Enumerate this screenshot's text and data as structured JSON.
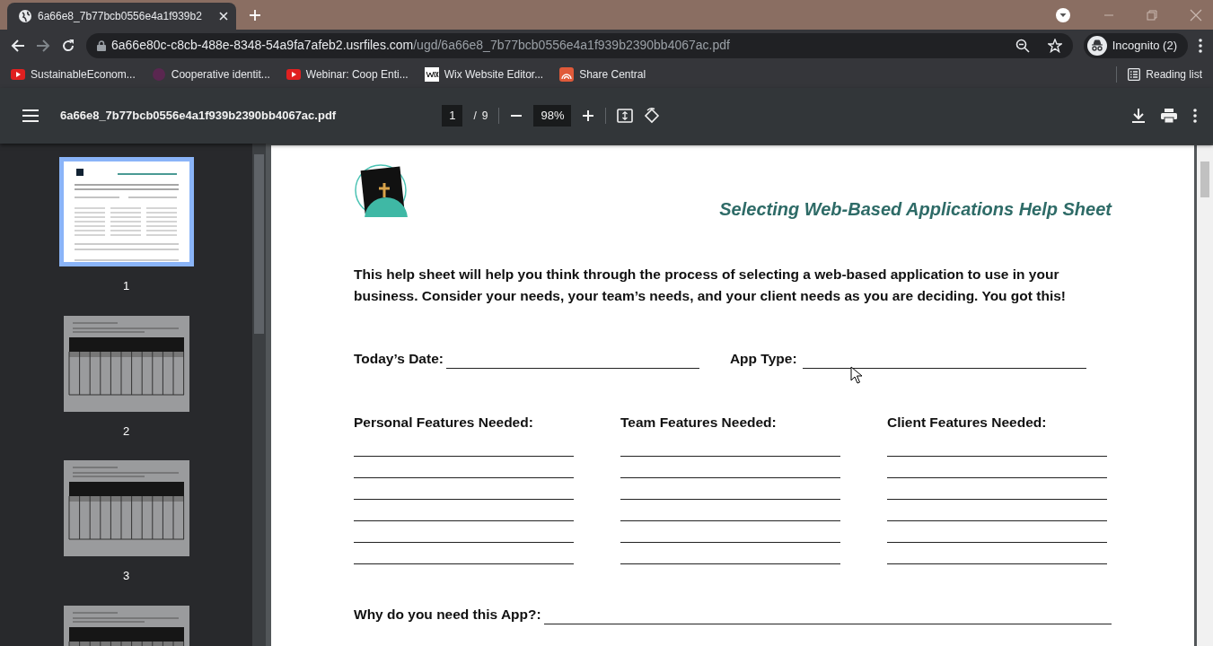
{
  "window": {
    "tab_title": "6a66e8_7b77bcb0556e4a1f939b2",
    "url_host": "6a66e80c-c8cb-488e-8348-54a9fa7afeb2.usrfiles.com",
    "url_path": "/ugd/6a66e8_7b77bcb0556e4a1f939b2390bb4067ac.pdf",
    "profile": "Incognito (2)",
    "bookmarks": [
      {
        "label": "SustainableEconom...",
        "kind": "video"
      },
      {
        "label": "Cooperative identit...",
        "kind": "site"
      },
      {
        "label": "Webinar: Coop Enti...",
        "kind": "video"
      },
      {
        "label": "Wix Website Editor...",
        "kind": "wix"
      },
      {
        "label": "Share Central",
        "kind": "share"
      }
    ],
    "reading_list": "Reading list"
  },
  "pdf_toolbar": {
    "filename": "6a66e8_7b77bcb0556e4a1f939b2390bb4067ac.pdf",
    "page": "1",
    "page_separator": "/",
    "page_total": "9",
    "zoom": "98%"
  },
  "thumbnails": [
    {
      "label": "1",
      "selected": true,
      "kind": "form"
    },
    {
      "label": "2",
      "selected": false,
      "kind": "table"
    },
    {
      "label": "3",
      "selected": false,
      "kind": "table"
    },
    {
      "selected": false,
      "kind": "table"
    }
  ],
  "document": {
    "title": "Selecting Web-Based Applications Help Sheet",
    "intro": "This help sheet will help you think through the process of selecting a web-based application to use in your business. Consider your needs, your team’s needs, and your client needs as you are deciding. You got this!",
    "date_label": "Today’s Date:",
    "app_type_label": "App Type:",
    "columns": [
      {
        "heading": "Personal Features Needed:"
      },
      {
        "heading": "Team Features Needed:"
      },
      {
        "heading": "Client Features Needed:"
      }
    ],
    "why_label": "Why do you need this App?:"
  }
}
